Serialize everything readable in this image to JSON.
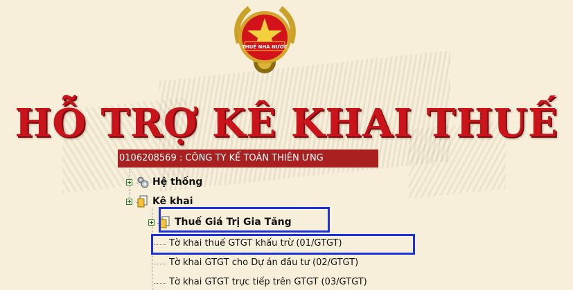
{
  "header": {
    "emblem_text": "THUẾ NHÀ NƯỚC",
    "banner_title": "HỖ TRỢ KÊ KHAI THUẾ"
  },
  "company": {
    "label": "0106208569 : CÔNG TY KẾ TOÁN THIÊN ƯNG"
  },
  "tree": {
    "system": "Hệ thống",
    "declaration": "Kê khai",
    "vat": "Thuế Giá Trị Gia Tăng",
    "items": [
      "Tờ khai thuế GTGT khấu trừ (01/GTGT)",
      "Tờ khai GTGT cho Dự án đầu tư (02/GTGT)",
      "Tờ khai GTGT trực tiếp trên GTGT (03/GTGT)"
    ]
  },
  "colors": {
    "banner_red": "#c8141a",
    "company_bar": "#a8201f",
    "highlight_blue": "#1a32d9",
    "background": "#f7efd9"
  }
}
